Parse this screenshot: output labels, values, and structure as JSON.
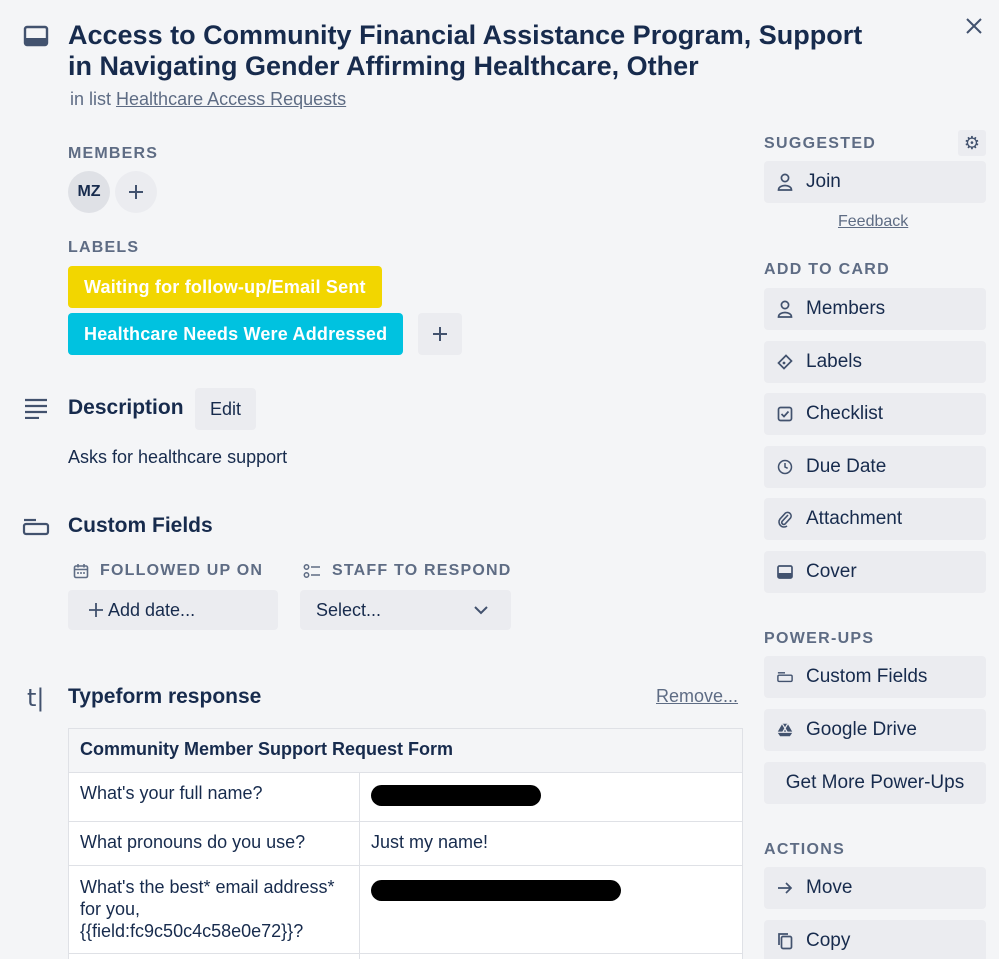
{
  "card": {
    "title": "Access to Community Financial Assistance Program, Support in Navigating Gender Affirming Healthcare, Other",
    "in_list_prefix": "in list",
    "list_name": "Healthcare Access Requests"
  },
  "members": {
    "heading": "MEMBERS",
    "initials": "MZ"
  },
  "labels": {
    "heading": "LABELS",
    "items": [
      {
        "text": "Waiting for follow-up/Email Sent",
        "color": "#f2d600"
      },
      {
        "text": "Healthcare Needs Were Addressed",
        "color": "#00c2e0"
      }
    ]
  },
  "description": {
    "heading": "Description",
    "edit_label": "Edit",
    "text": "Asks for healthcare support"
  },
  "custom_fields": {
    "heading": "Custom Fields",
    "followed_label": "FOLLOWED UP ON",
    "followed_value": "Add date...",
    "staff_label": "STAFF TO RESPOND",
    "staff_value": "Select..."
  },
  "typeform": {
    "heading": "Typeform response",
    "remove_label": "Remove...",
    "table_title": "Community Member Support Request Form",
    "rows": [
      {
        "q": "What's your full name?",
        "a": ""
      },
      {
        "q": "What pronouns do you use?",
        "a": "Just my name!"
      },
      {
        "q": "What's the best* email address* for you, {{field:fc9c50c4c58e0e72}}?",
        "a": ""
      }
    ]
  },
  "sidebar": {
    "suggested_heading": "SUGGESTED",
    "join_label": "Join",
    "feedback_label": "Feedback",
    "add_to_card_heading": "ADD TO CARD",
    "add_items": [
      "Members",
      "Labels",
      "Checklist",
      "Due Date",
      "Attachment",
      "Cover"
    ],
    "powerups_heading": "POWER-UPS",
    "powerup_items": [
      "Custom Fields",
      "Google Drive"
    ],
    "get_more_label": "Get More Power-Ups",
    "actions_heading": "ACTIONS",
    "action_items": [
      "Move",
      "Copy"
    ]
  }
}
